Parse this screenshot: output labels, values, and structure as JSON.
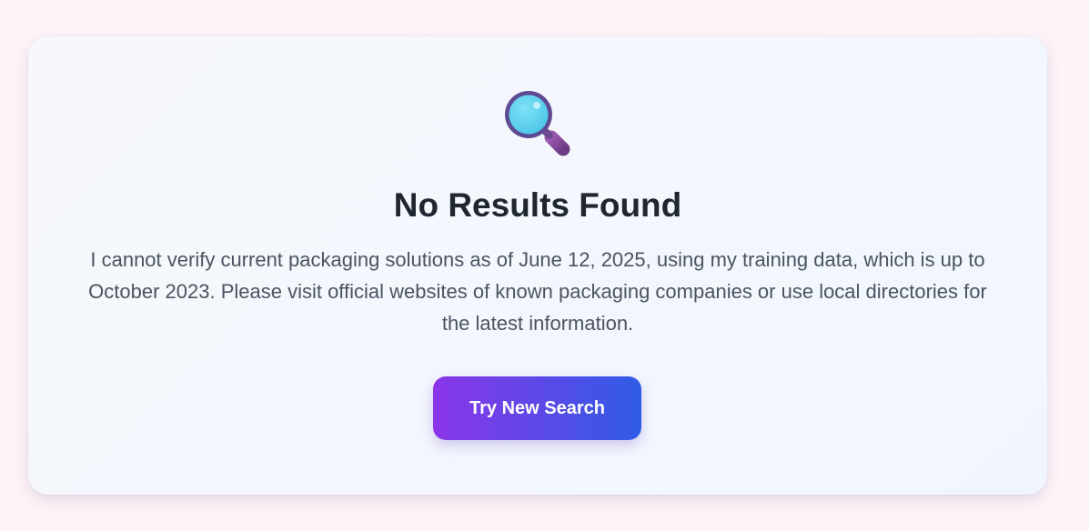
{
  "empty_state": {
    "icon": "magnifying-glass-icon",
    "title": "No Results Found",
    "message": "I cannot verify current packaging solutions as of June 12, 2025, using my training data, which is up to October 2023. Please visit official websites of known packaging companies or use local directories for the latest information.",
    "button_label": "Try New Search"
  },
  "colors": {
    "background": "#fdf4f8",
    "card": "#f4f7fd",
    "title": "#1f2630",
    "message": "#4b5361",
    "button_gradient_start": "#8b35e8",
    "button_gradient_end": "#2f5ce6",
    "button_text": "#ffffff"
  }
}
